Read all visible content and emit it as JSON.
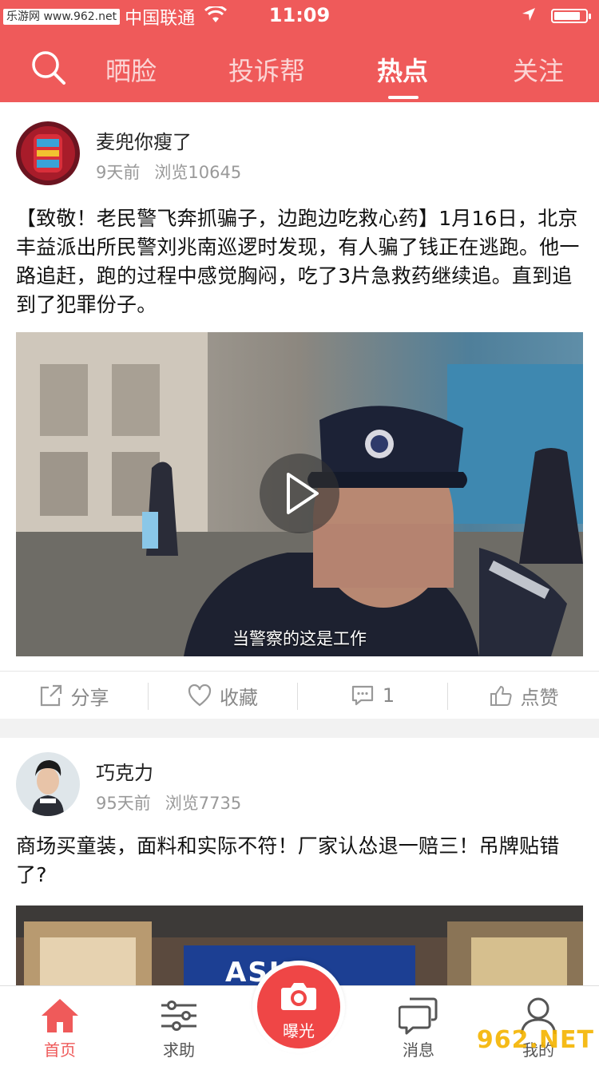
{
  "status_bar": {
    "watermark": "乐游网 www.962.net",
    "carrier": "中国联通",
    "time": "11:09",
    "battery_level": 0.85
  },
  "nav": {
    "tabs": [
      {
        "label": "晒脸"
      },
      {
        "label": "投诉帮"
      },
      {
        "label": "热点"
      },
      {
        "label": "关注"
      }
    ],
    "active_tab": "热点",
    "accent_color": "#ef5a5a"
  },
  "posts": [
    {
      "username": "麦兜你瘦了",
      "time_ago": "9天前",
      "views": "浏览10645",
      "text": "【致敬！老民警飞奔抓骗子，边跑边吃救心药】1月16日，北京丰益派出所民警刘兆南巡逻时发现，有人骗了钱正在逃跑。他一路追赶，跑的过程中感觉胸闷，吃了3片急救药继续追。直到追到了犯罪份子。",
      "video_caption": "当警察的这是工作",
      "actions": {
        "share": "分享",
        "favorite": "收藏",
        "comments": "1",
        "like": "点赞"
      }
    },
    {
      "username": "巧克力",
      "time_ago": "95天前",
      "views": "浏览7735",
      "text": "商场买童装，面料和实际不符！厂家认怂退一赔三！吊牌贴错了?",
      "image_sign": "ASK"
    }
  ],
  "tabbar": {
    "items": [
      {
        "label": "首页"
      },
      {
        "label": "求助"
      },
      {
        "label": "曝光"
      },
      {
        "label": "消息"
      },
      {
        "label": "我的"
      }
    ],
    "watermark": "962.NET"
  }
}
